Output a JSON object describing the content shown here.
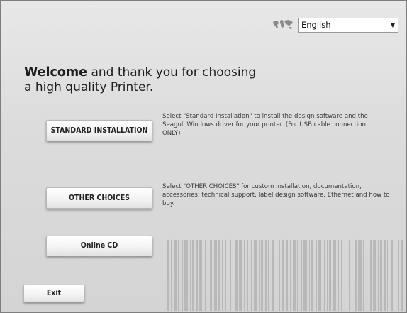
{
  "language": {
    "icon": "globe-map-icon",
    "selected": "English"
  },
  "welcome": {
    "bold": "Welcome",
    "rest_line1": " and thank you for choosing",
    "line2": "a high quality Printer."
  },
  "options": {
    "standard": {
      "label": "STANDARD INSTALLATION",
      "description": "Select \"Standard Installation\" to install the design software and the Seagull Windows driver for your printer. (For USB cable connection ONLY)"
    },
    "other": {
      "label": "OTHER CHOICES",
      "description": "Select \"OTHER CHOICES\" for custom installation, documentation, accessories, technical support, label design software, Ethernet and how to buy."
    },
    "online": {
      "label": "Online CD"
    }
  },
  "exit": {
    "label": "Exit"
  },
  "colors": {
    "background": "#dcdcdc",
    "barcode": "#b8b8b8",
    "text": "#1d1d1d"
  }
}
